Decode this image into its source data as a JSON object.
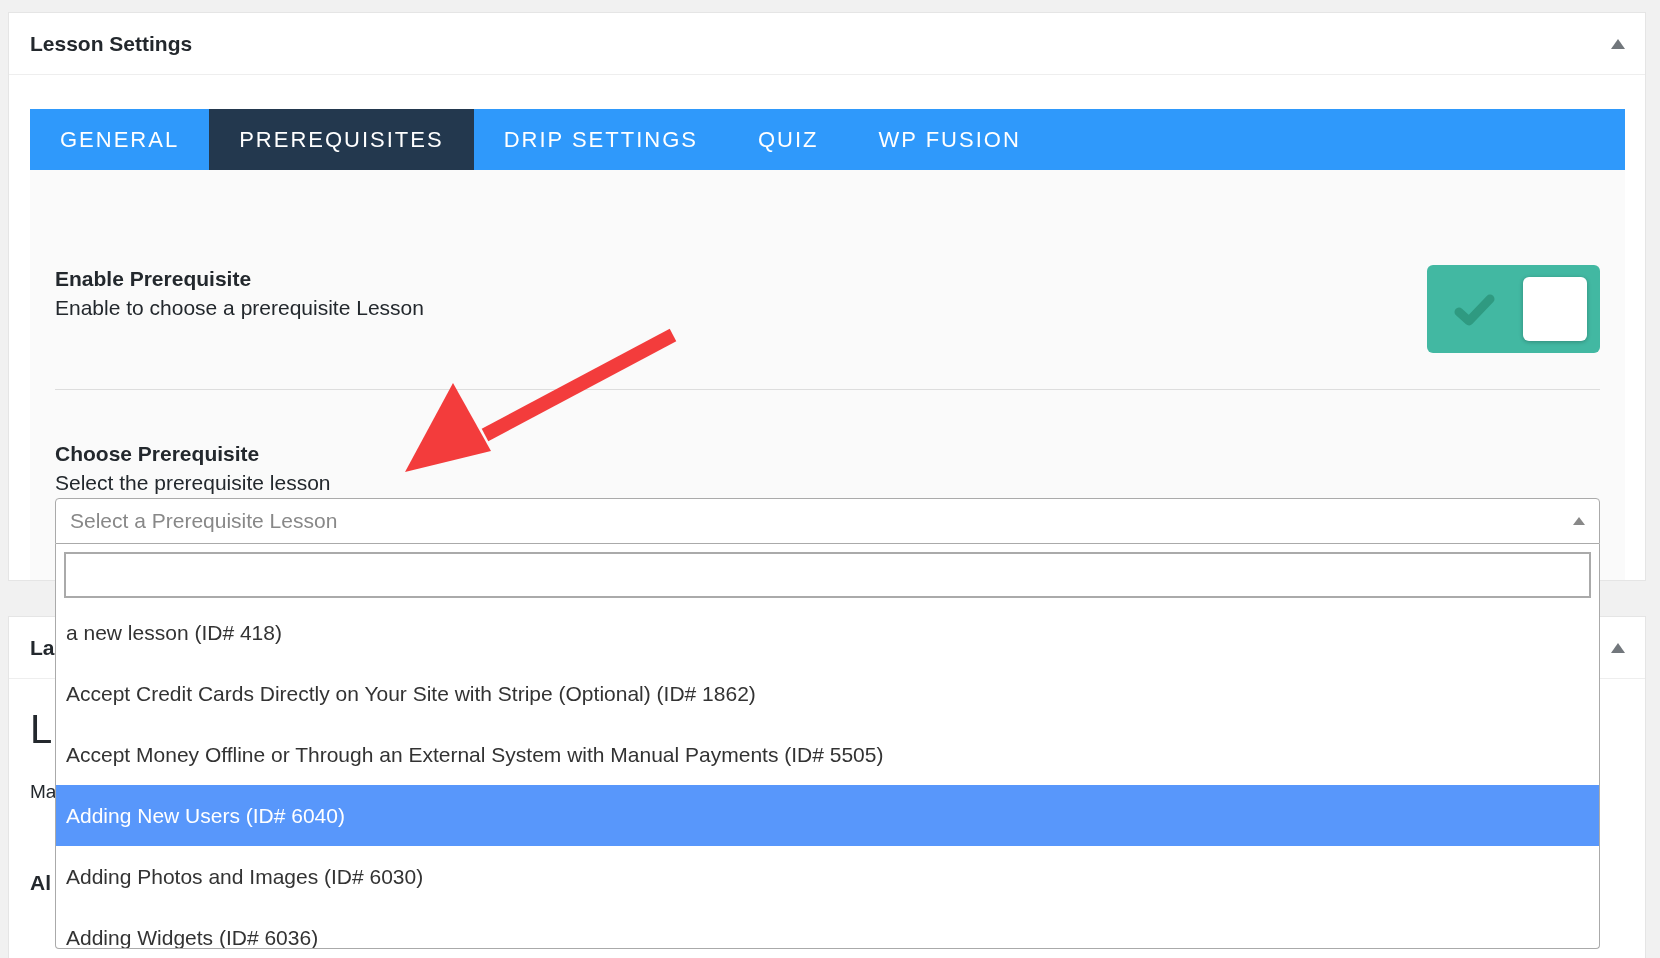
{
  "panel": {
    "title": "Lesson Settings"
  },
  "tabs": [
    {
      "label": "GENERAL",
      "selected": false
    },
    {
      "label": "PREREQUISITES",
      "selected": true
    },
    {
      "label": "DRIP SETTINGS",
      "selected": false
    },
    {
      "label": "QUIZ",
      "selected": false
    },
    {
      "label": "WP FUSION",
      "selected": false
    }
  ],
  "toggle_setting": {
    "title": "Enable Prerequisite",
    "description": "Enable to choose a prerequisite Lesson",
    "on": true
  },
  "select_setting": {
    "title": "Choose Prerequisite",
    "description": "Select the prerequisite lesson",
    "placeholder": "Select a Prerequisite Lesson",
    "expanded": true,
    "options": [
      {
        "label": "a new lesson (ID# 418)",
        "selected": false
      },
      {
        "label": "Accept Credit Cards Directly on Your Site with Stripe (Optional) (ID# 1862)",
        "selected": false
      },
      {
        "label": "Accept Money Offline or Through an External System with Manual Payments (ID# 5505)",
        "selected": false
      },
      {
        "label": "Adding New Users (ID# 6040)",
        "selected": true
      },
      {
        "label": "Adding Photos and Images (ID# 6030)",
        "selected": false
      },
      {
        "label": "Adding Widgets (ID# 6036)",
        "selected": false
      }
    ]
  },
  "second_panel": {
    "title": "La",
    "heading": "L",
    "text": "Ma",
    "label": "Al"
  }
}
